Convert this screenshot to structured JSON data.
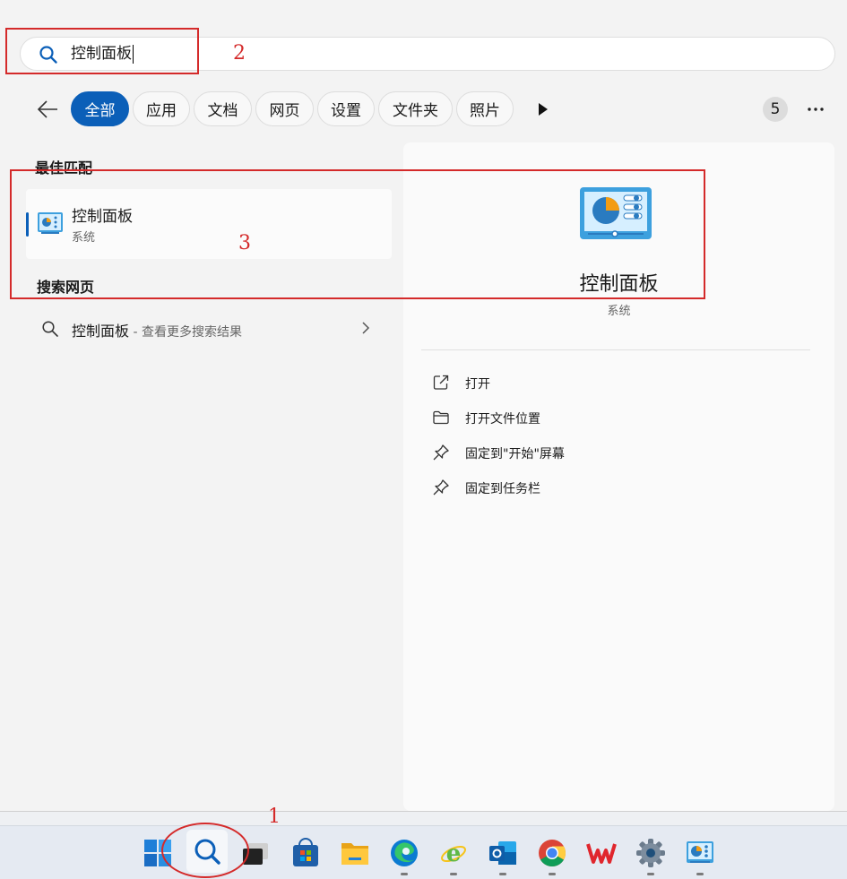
{
  "search": {
    "value": "控制面板",
    "icon": "search-icon"
  },
  "filters": {
    "back_icon": "back-arrow-icon",
    "items": [
      "全部",
      "应用",
      "文档",
      "网页",
      "设置",
      "文件夹",
      "照片"
    ],
    "active_index": 0,
    "more_results_icon": "play-arrow-icon",
    "badge": "5",
    "more_icon": "ellipsis-icon"
  },
  "best_match": {
    "section_title": "最佳匹配",
    "name": "控制面板",
    "category": "系统",
    "icon": "control-panel-icon"
  },
  "web_search": {
    "section_title": "搜索网页",
    "query": "控制面板",
    "suffix": " - 查看更多搜索结果",
    "icon": "search-icon",
    "chevron": "chevron-right-icon"
  },
  "detail": {
    "title": "控制面板",
    "subtitle": "系统",
    "actions": [
      {
        "label": "打开",
        "icon": "open-external-icon"
      },
      {
        "label": "打开文件位置",
        "icon": "folder-icon"
      },
      {
        "label": "固定到\"开始\"屏幕",
        "icon": "pin-icon"
      },
      {
        "label": "固定到任务栏",
        "icon": "pin-icon"
      }
    ]
  },
  "annotations": {
    "one": "1",
    "two": "2",
    "three": "3",
    "color": "#d42a2a"
  },
  "taskbar": {
    "items": [
      "start-icon",
      "search-icon",
      "task-view-icon",
      "store-icon",
      "file-explorer-icon",
      "edge-icon",
      "ie-icon",
      "outlook-icon",
      "chrome-icon",
      "wps-icon",
      "settings-icon",
      "control-panel-icon"
    ]
  },
  "colors": {
    "accent": "#0b5fb8",
    "panel_bg": "#f3f3f3"
  }
}
